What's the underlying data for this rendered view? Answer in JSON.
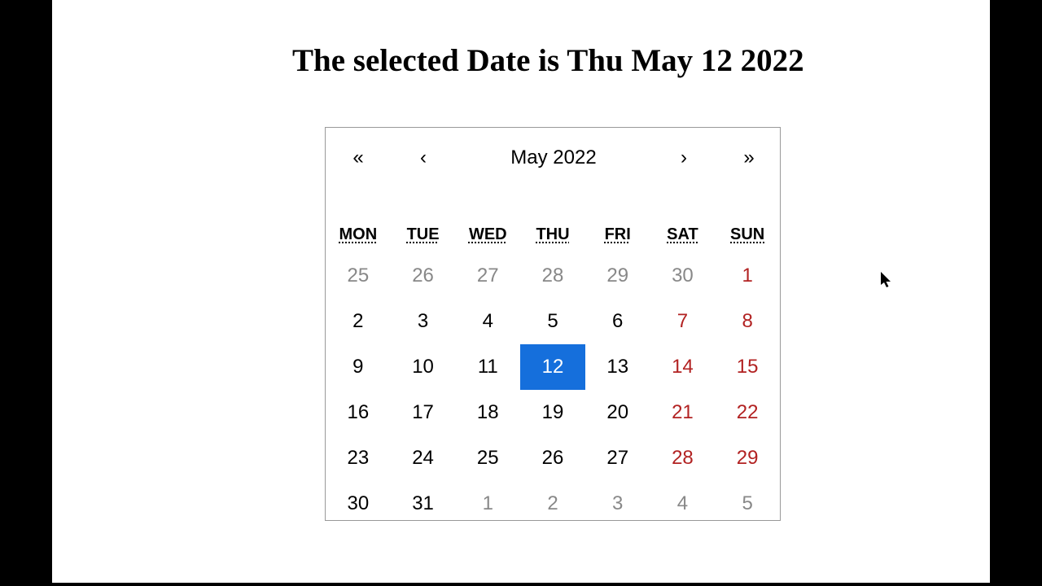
{
  "title": "The selected Date is Thu May 12 2022",
  "nav": {
    "prev_year_glyph": "«",
    "prev_month_glyph": "‹",
    "month_label": "May 2022",
    "next_month_glyph": "›",
    "next_year_glyph": "»"
  },
  "weekdays": [
    "MON",
    "TUE",
    "WED",
    "THU",
    "FRI",
    "SAT",
    "SUN"
  ],
  "days": [
    {
      "n": "25",
      "cls": "prev"
    },
    {
      "n": "26",
      "cls": "prev"
    },
    {
      "n": "27",
      "cls": "prev"
    },
    {
      "n": "28",
      "cls": "prev"
    },
    {
      "n": "29",
      "cls": "prev"
    },
    {
      "n": "30",
      "cls": "prev"
    },
    {
      "n": "1",
      "cls": "weekend"
    },
    {
      "n": "2",
      "cls": ""
    },
    {
      "n": "3",
      "cls": ""
    },
    {
      "n": "4",
      "cls": ""
    },
    {
      "n": "5",
      "cls": ""
    },
    {
      "n": "6",
      "cls": ""
    },
    {
      "n": "7",
      "cls": "weekend"
    },
    {
      "n": "8",
      "cls": "weekend"
    },
    {
      "n": "9",
      "cls": ""
    },
    {
      "n": "10",
      "cls": ""
    },
    {
      "n": "11",
      "cls": ""
    },
    {
      "n": "12",
      "cls": "selected"
    },
    {
      "n": "13",
      "cls": ""
    },
    {
      "n": "14",
      "cls": "weekend"
    },
    {
      "n": "15",
      "cls": "weekend"
    },
    {
      "n": "16",
      "cls": ""
    },
    {
      "n": "17",
      "cls": ""
    },
    {
      "n": "18",
      "cls": ""
    },
    {
      "n": "19",
      "cls": ""
    },
    {
      "n": "20",
      "cls": ""
    },
    {
      "n": "21",
      "cls": "weekend"
    },
    {
      "n": "22",
      "cls": "weekend"
    },
    {
      "n": "23",
      "cls": ""
    },
    {
      "n": "24",
      "cls": ""
    },
    {
      "n": "25",
      "cls": ""
    },
    {
      "n": "26",
      "cls": ""
    },
    {
      "n": "27",
      "cls": ""
    },
    {
      "n": "28",
      "cls": "weekend"
    },
    {
      "n": "29",
      "cls": "weekend"
    },
    {
      "n": "30",
      "cls": ""
    },
    {
      "n": "31",
      "cls": ""
    },
    {
      "n": "1",
      "cls": "next"
    },
    {
      "n": "2",
      "cls": "next"
    },
    {
      "n": "3",
      "cls": "next"
    },
    {
      "n": "4",
      "cls": "next"
    },
    {
      "n": "5",
      "cls": "next"
    }
  ]
}
